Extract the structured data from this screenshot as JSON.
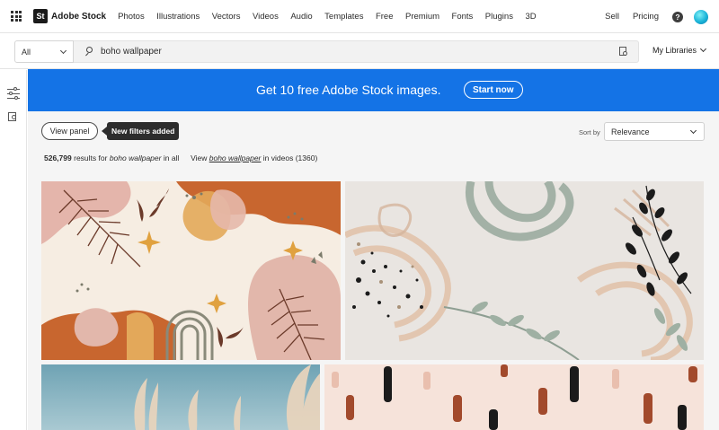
{
  "nav": {
    "brand_mark": "St",
    "brand_name": "Adobe Stock",
    "links": [
      "Photos",
      "Illustrations",
      "Vectors",
      "Videos",
      "Audio",
      "Templates",
      "Free",
      "Premium",
      "Fonts",
      "Plugins",
      "3D"
    ],
    "right_links": [
      "Sell",
      "Pricing"
    ],
    "help_glyph": "?"
  },
  "search": {
    "scope": "All",
    "query": "boho wallpaper",
    "my_libraries": "My Libraries"
  },
  "banner": {
    "text": "Get 10 free Adobe Stock images.",
    "button": "Start now",
    "color": "#1473e6"
  },
  "toolbar": {
    "view_panel": "View panel",
    "tooltip": "New filters added",
    "sort_label": "Sort by",
    "sort_value": "Relevance"
  },
  "results": {
    "count": "526,799",
    "mid": "results for",
    "query": "boho wallpaper",
    "in_all": "in all",
    "view_label": "View",
    "video_link": "boho wallpaper",
    "in_videos": "in videos",
    "video_count": "(1360)"
  },
  "thumbnails": [
    {
      "name": "boho-abstract-pink-terracotta"
    },
    {
      "name": "boho-abstract-sage-leaves"
    },
    {
      "name": "pampas-grass-sky"
    },
    {
      "name": "boho-brush-strokes-pattern"
    }
  ],
  "icons": [
    "apps-grid-icon",
    "search-icon",
    "visual-search-icon",
    "chevron-down-icon",
    "help-icon",
    "filter-icon",
    "libraries-icon"
  ]
}
